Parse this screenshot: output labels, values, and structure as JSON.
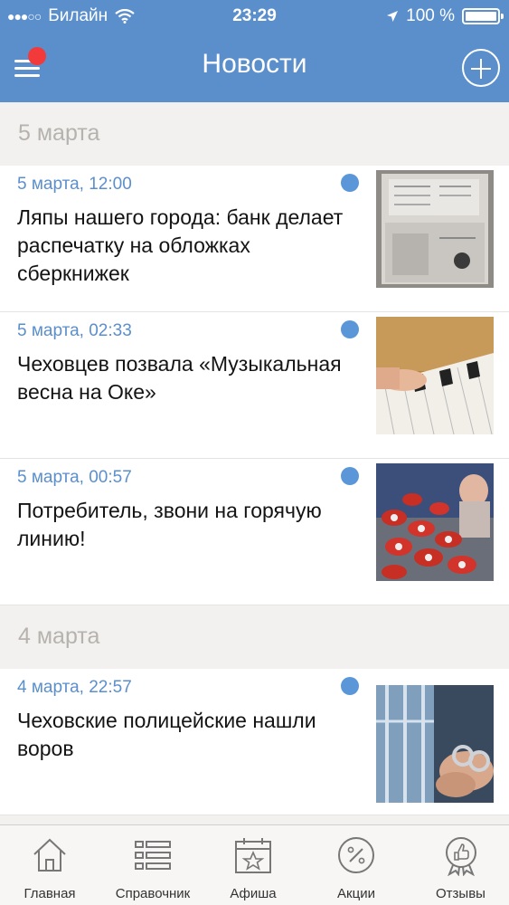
{
  "status_bar": {
    "carrier": "Билайн",
    "time": "23:29",
    "battery": "100 %"
  },
  "header": {
    "title": "Новости"
  },
  "sections": [
    {
      "date_header": "5 марта",
      "items": [
        {
          "datetime": "5 марта, 12:00",
          "headline": "Ляпы нашего города: банк делает распечатку на обложках сберкнижек",
          "image": "savings-book-photo"
        },
        {
          "datetime": "5 марта, 02:33",
          "headline": "Чеховцев позвала «Музыкальная весна на Оке»",
          "image": "piano-keys-photo"
        },
        {
          "datetime": "5 марта, 00:57",
          "headline": "Потребитель, звони на горячую линию!",
          "image": "hotline-phones-photo"
        }
      ]
    },
    {
      "date_header": "4 марта",
      "items": [
        {
          "datetime": "4 марта, 22:57",
          "headline": "Чеховские полицейские нашли воров",
          "image": "handcuffs-photo"
        }
      ]
    }
  ],
  "tabbar": {
    "tabs": [
      {
        "label": "Главная",
        "icon": "home-icon"
      },
      {
        "label": "Справочник",
        "icon": "list-icon"
      },
      {
        "label": "Афиша",
        "icon": "calendar-star-icon"
      },
      {
        "label": "Акции",
        "icon": "percent-icon"
      },
      {
        "label": "Отзывы",
        "icon": "thumbs-up-badge-icon"
      }
    ]
  },
  "colors": {
    "accent": "#5b8fcc",
    "notification": "#f33a3a",
    "background": "#f2f1ef"
  }
}
